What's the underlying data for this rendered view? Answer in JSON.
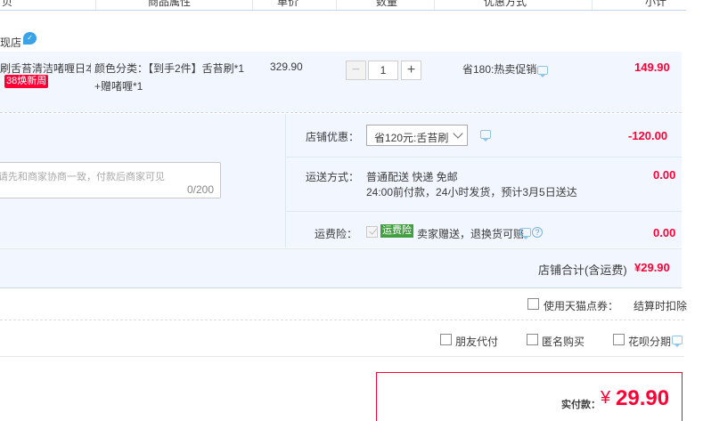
{
  "table_header": {
    "shop_fragment": "贝",
    "attr": "商品属性",
    "price": "单价",
    "qty": "数量",
    "discount": "优惠方式",
    "subtotal": "小计"
  },
  "shop": {
    "name_fragment": "现店"
  },
  "item": {
    "title": "刷舌苔清洁啫喱日本...",
    "badge": "38焕新周",
    "attr_line1": "颜色分类：【到手2件】舌苔刷*1",
    "attr_line2": "+赠啫喱*1",
    "unit_price": "329.90",
    "minus": "−",
    "quantity": "1",
    "plus": "+",
    "discount": "省180:热卖促销",
    "subtotal": "149.90"
  },
  "shop_promo": {
    "label": "店铺优惠：",
    "selected": "省120元:舌苔刷",
    "amount": "-120.00"
  },
  "message": {
    "placeholder": "请先和商家协商一致，付款后商家可见",
    "counter": "0/200"
  },
  "shipping": {
    "label": "运送方式：",
    "line1": "普通配送 快递 免邮",
    "line2": "24:00前付款，24小时发货，预计3月5日送达",
    "amount": "0.00"
  },
  "insurance": {
    "label": "运费险：",
    "badge": "运费险",
    "text": "卖家赠送，退换货可赔",
    "help": "?",
    "amount": "0.00"
  },
  "shop_total": {
    "label": "店铺合计(含运费)",
    "amount": "¥29.90"
  },
  "tmall_points": {
    "label": "使用天猫点券：",
    "note": "结算时扣除"
  },
  "options": {
    "friend_pay": "朋友代付",
    "anonymous": "匿名购买",
    "huabei": "花呗分期"
  },
  "final": {
    "label": "实付款：",
    "currency": "¥",
    "amount": "29.90"
  },
  "colors": {
    "red": "#ff0036",
    "blue_panel": "#f2f7ff",
    "green": "#42a042"
  }
}
